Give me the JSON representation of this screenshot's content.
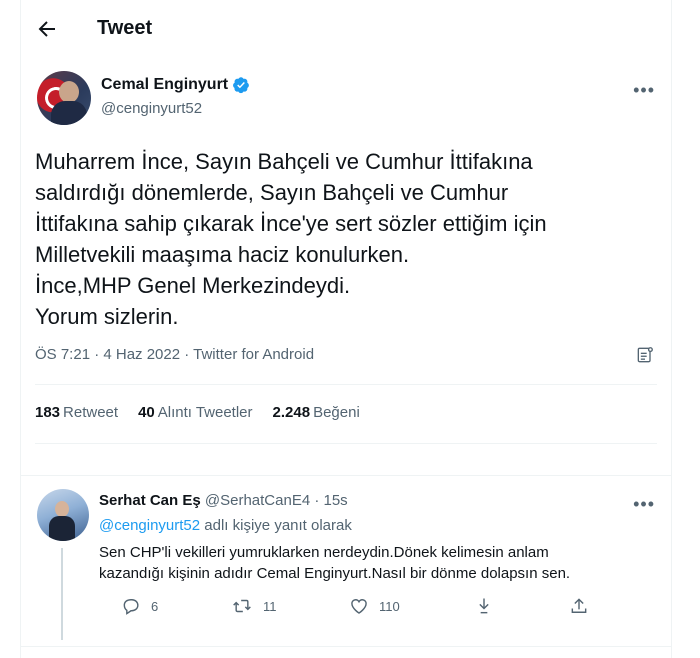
{
  "header": {
    "title": "Tweet",
    "back_icon": "arrow-left-icon"
  },
  "tweet": {
    "author": {
      "name": "Cemal Enginyurt",
      "handle": "@cenginyurt52",
      "verified": true
    },
    "more_label": "•••",
    "text_lines": [
      "Muharrem İnce, Sayın Bahçeli ve Cumhur İttifakına",
      "saldırdığı dönemlerde, Sayın Bahçeli ve Cumhur",
      "İttifakına sahip çıkarak İnce'ye sert sözler ettiğim için",
      "Milletvekili maaşıma haciz konulurken.",
      "İnce,MHP Genel Merkezindeydi.",
      "Yorum sizlerin."
    ],
    "meta": "ÖS 7:21 · 4 Haz 2022 · Twitter for Android",
    "stats": {
      "retweets": {
        "count": "183",
        "label": "Retweet"
      },
      "quotes": {
        "count": "40",
        "label": "Alıntı Tweetler"
      },
      "likes": {
        "count": "2.248",
        "label": "Beğeni"
      }
    }
  },
  "reply": {
    "name": "Serhat Can Eş",
    "sub": " @SerhatCanE4 · 15s",
    "more_label": "•••",
    "replying_mention": "@cenginyurt52",
    "replying_suffix": " adlı kişiye yanıt olarak",
    "text_lines": [
      "Sen CHP'li vekilleri  yumruklarken nerdeydin.Dönek kelimesin anlam",
      "kazandığı kişinin adıdır Cemal Enginyurt.Nasıl bir dönme dolapsın sen."
    ],
    "actions": {
      "replies": "6",
      "retweets": "11",
      "likes": "110"
    }
  },
  "colors": {
    "accent": "#1d9bf0",
    "text": "#0f1419",
    "muted": "#536471"
  }
}
